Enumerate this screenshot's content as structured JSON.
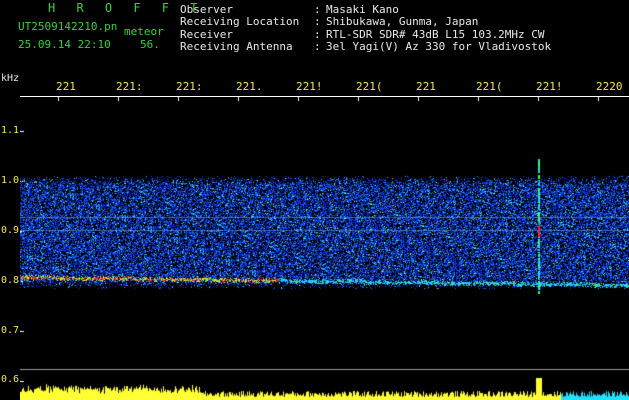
{
  "header": {
    "brand": "H R O F F T",
    "file_name": "UT2509142210.pn",
    "mode": "meteor",
    "date_time": "25.09.14 22:10",
    "seconds": "56.",
    "info": [
      {
        "label": "Observer",
        "value": "Masaki Kano"
      },
      {
        "label": "Receiving Location",
        "value": "Shibukawa, Gunma, Japan"
      },
      {
        "label": "Receiver",
        "value": "RTL-SDR SDR# 43dB L15 103.2MHz CW"
      },
      {
        "label": "Receiving Antenna",
        "value": "3el Yagi(V) Az 330 for Vladivostok"
      }
    ]
  },
  "axis": {
    "unit": "kHz",
    "y_ticks": [
      "1.1",
      "1.0",
      "0.9",
      "0.8",
      "0.7",
      "0.6"
    ],
    "x_ticks": [
      "221",
      "221:",
      "221:",
      "221.",
      "221!",
      "221(",
      "221",
      "221(",
      "221!",
      "2220"
    ]
  },
  "colors": {
    "background": "#000000",
    "noise": "#1240ff",
    "tick_text": "#f3e84c",
    "header_text": "#e8e8e8",
    "brand_text": "#3ad03a",
    "signal_hot": "#ff2a1a",
    "signal_warm": "#ffe22a",
    "bottom_bar": "#ffff33",
    "bottom_bar_right": "#22e0ff"
  }
}
